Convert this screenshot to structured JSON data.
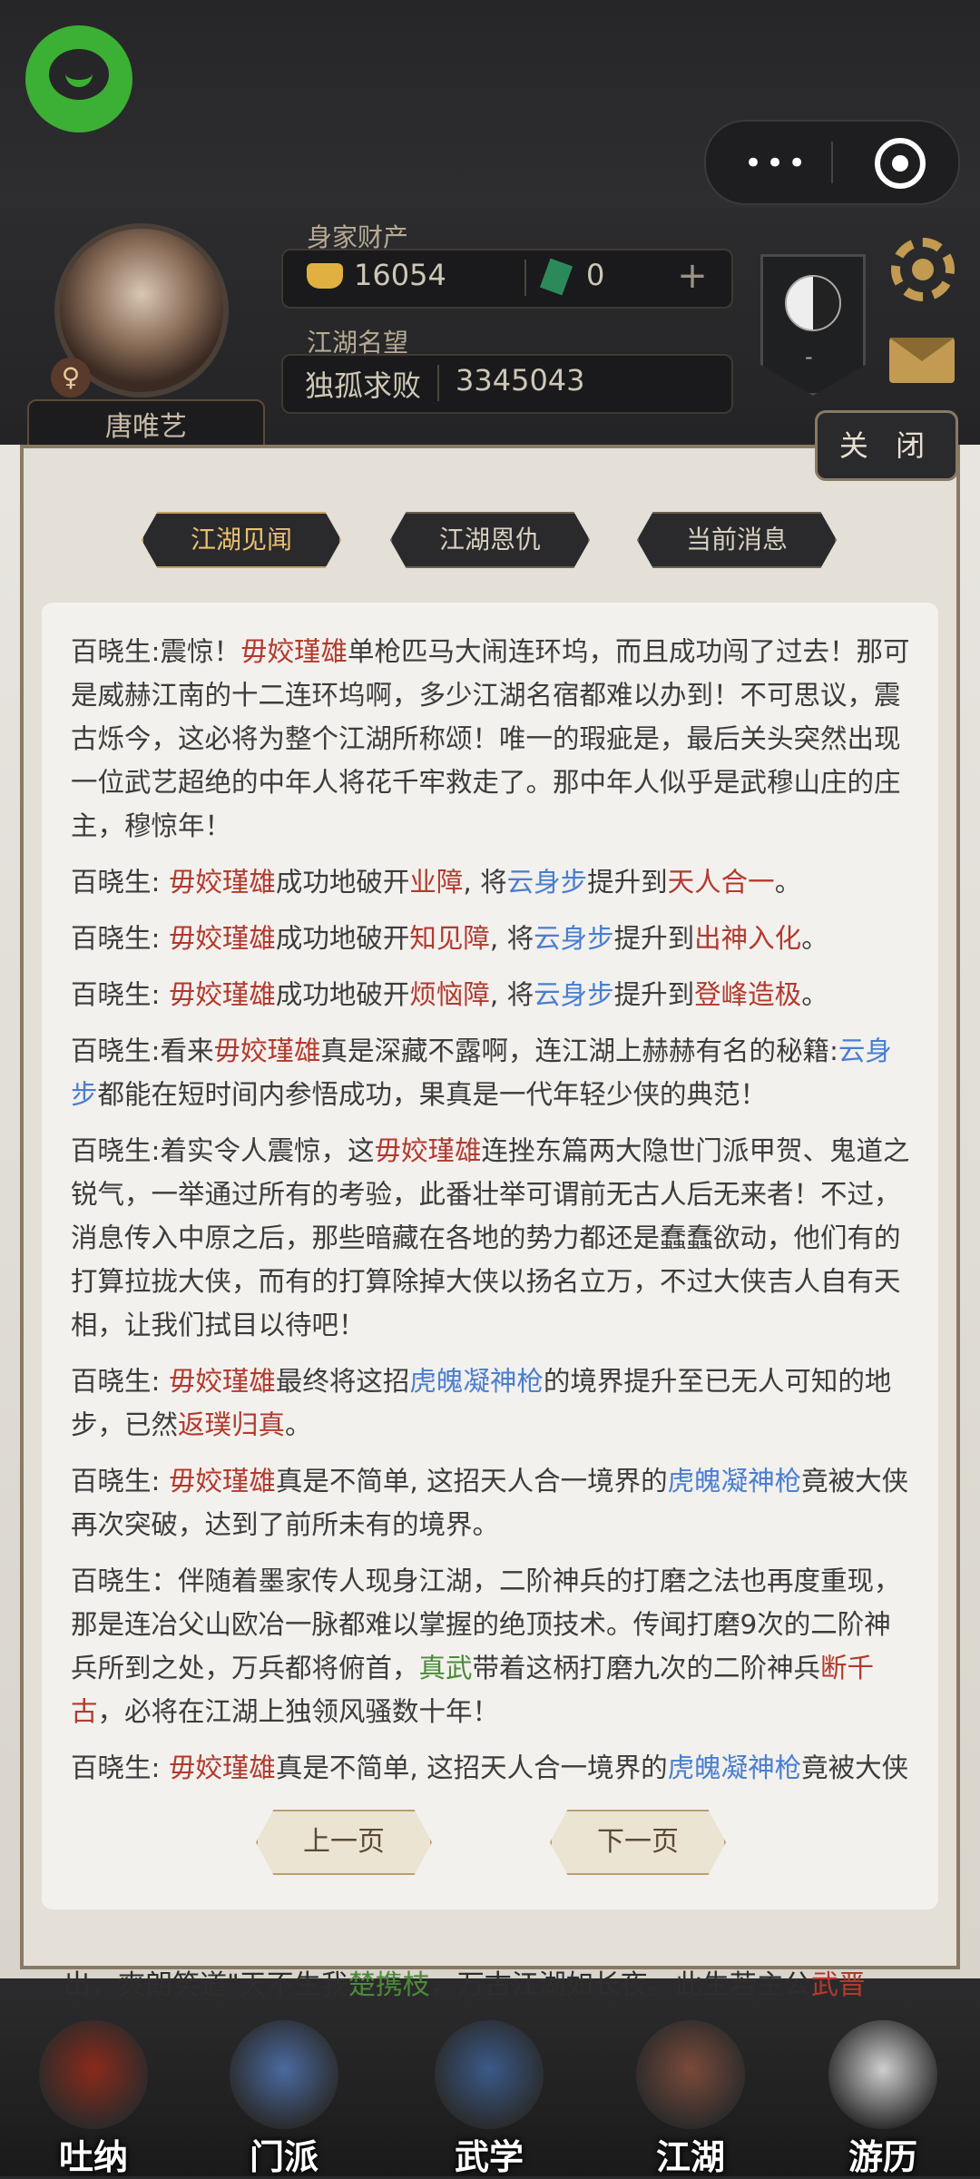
{
  "top_bar": {
    "capsule_menu": "•••"
  },
  "player": {
    "name": "唐唯艺",
    "gender_symbol": "♀",
    "wealth_label": "身家财产",
    "gold": "16054",
    "jade": "0",
    "plus": "+",
    "reputation_label": "江湖名望",
    "title": "独孤求败",
    "reputation_value": "3345043",
    "badge_value": "-"
  },
  "modal": {
    "close_label": "关 闭",
    "tabs": [
      {
        "label": "江湖见闻",
        "active": true
      },
      {
        "label": "江湖恩仇",
        "active": false
      },
      {
        "label": "当前消息",
        "active": false
      }
    ],
    "messages": [
      {
        "segments": [
          {
            "t": "百晓生:震惊！"
          },
          {
            "t": "毋姣瑾雄",
            "c": "r"
          },
          {
            "t": "单枪匹马大闹连环坞，而且成功闯了过去！那可是威赫江南的十二连环坞啊，多少江湖名宿都难以办到！不可思议，震古烁今，这必将为整个江湖所称颂！唯一的瑕疵是，最后关头突然出现一位武艺超绝的中年人将花千牢救走了。那中年人似乎是武穆山庄的庄主，穆惊年！"
          }
        ]
      },
      {
        "segments": [
          {
            "t": "百晓生: "
          },
          {
            "t": "毋姣瑾雄",
            "c": "r"
          },
          {
            "t": "成功地破开"
          },
          {
            "t": "业障",
            "c": "r"
          },
          {
            "t": ", 将"
          },
          {
            "t": "云身步",
            "c": "b"
          },
          {
            "t": "提升到"
          },
          {
            "t": "天人合一",
            "c": "r"
          },
          {
            "t": "。"
          }
        ]
      },
      {
        "segments": [
          {
            "t": "百晓生: "
          },
          {
            "t": "毋姣瑾雄",
            "c": "r"
          },
          {
            "t": "成功地破开"
          },
          {
            "t": "知见障",
            "c": "r"
          },
          {
            "t": ", 将"
          },
          {
            "t": "云身步",
            "c": "b"
          },
          {
            "t": "提升到"
          },
          {
            "t": "出神入化",
            "c": "r"
          },
          {
            "t": "。"
          }
        ]
      },
      {
        "segments": [
          {
            "t": "百晓生: "
          },
          {
            "t": "毋姣瑾雄",
            "c": "r"
          },
          {
            "t": "成功地破开"
          },
          {
            "t": "烦恼障",
            "c": "r"
          },
          {
            "t": ", 将"
          },
          {
            "t": "云身步",
            "c": "b"
          },
          {
            "t": "提升到"
          },
          {
            "t": "登峰造极",
            "c": "r"
          },
          {
            "t": "。"
          }
        ]
      },
      {
        "segments": [
          {
            "t": "百晓生:看来"
          },
          {
            "t": "毋姣瑾雄",
            "c": "r"
          },
          {
            "t": "真是深藏不露啊，连江湖上赫赫有名的秘籍:"
          },
          {
            "t": "云身步",
            "c": "b"
          },
          {
            "t": "都能在短时间内参悟成功，果真是一代年轻少侠的典范！"
          }
        ]
      },
      {
        "segments": [
          {
            "t": "百晓生:着实令人震惊，这"
          },
          {
            "t": "毋姣瑾雄",
            "c": "r"
          },
          {
            "t": "连挫东篇两大隐世门派甲贺、鬼道之锐气，一举通过所有的考验，此番壮举可谓前无古人后无来者！不过，消息传入中原之后，那些暗藏在各地的势力都还是蠢蠢欲动，他们有的打算拉拢大侠，而有的打算除掉大侠以扬名立万，不过大侠吉人自有天相，让我们拭目以待吧！"
          }
        ]
      },
      {
        "segments": [
          {
            "t": "百晓生: "
          },
          {
            "t": "毋姣瑾雄",
            "c": "r"
          },
          {
            "t": "最终将这招"
          },
          {
            "t": "虎魄凝神枪",
            "c": "b"
          },
          {
            "t": "的境界提升至已无人可知的地步，已然"
          },
          {
            "t": "返璞归真",
            "c": "r"
          },
          {
            "t": "。"
          }
        ]
      },
      {
        "segments": [
          {
            "t": "百晓生: "
          },
          {
            "t": "毋姣瑾雄",
            "c": "r"
          },
          {
            "t": "真是不简单, 这招天人合一境界的"
          },
          {
            "t": "虎魄凝神枪",
            "c": "b"
          },
          {
            "t": "竟被大侠再次突破，达到了前所未有的境界。"
          }
        ]
      },
      {
        "segments": [
          {
            "t": "百晓生：伴随着墨家传人现身江湖，二阶神兵的打磨之法也再度重现，那是连冶父山欧冶一脉都难以掌握的绝顶技术。传闻打磨9次的二阶神兵所到之处，万兵都将俯首，"
          },
          {
            "t": "真武",
            "c": "g"
          },
          {
            "t": "带着这柄打磨九次的二阶神兵"
          },
          {
            "t": "断千古",
            "c": "r"
          },
          {
            "t": "，必将在江湖上独领风骚数十年！"
          }
        ]
      },
      {
        "segments": [
          {
            "t": "百晓生: "
          },
          {
            "t": "毋姣瑾雄",
            "c": "r"
          },
          {
            "t": "真是不简单, 这招天人合一境界的"
          },
          {
            "t": "虎魄凝神枪",
            "c": "b"
          },
          {
            "t": "竟被大侠再次突破，达到了前所未有的境界。"
          }
        ]
      }
    ],
    "prev_label": "上一页",
    "next_label": "下一页"
  },
  "marquee": {
    "segments": [
      {
        "t": "出，爽朗笑道\"天不生我"
      },
      {
        "t": "楚携枝",
        "c": "g"
      },
      {
        "t": "，万古江湖如长夜。此生若主公"
      },
      {
        "t": "武晋",
        "c": "r"
      }
    ]
  },
  "bottom_nav": [
    {
      "label": "吐纳",
      "icon": "gourd-icon",
      "color": "#8a2a1a"
    },
    {
      "label": "门派",
      "icon": "sect-banner-icon",
      "color": "#4a6aa0"
    },
    {
      "label": "武学",
      "icon": "scroll-book-icon",
      "color": "#3a5a8a"
    },
    {
      "label": "江湖",
      "icon": "straw-hat-icon",
      "color": "#7a4a3a"
    },
    {
      "label": "游历",
      "icon": "horse-icon",
      "color": "#cfcfcf"
    }
  ],
  "colors": {
    "highlight_red": "#b23a2e",
    "highlight_blue": "#4a7ed0",
    "highlight_green": "#4c8a3a",
    "gold_accent": "#c29a52"
  }
}
